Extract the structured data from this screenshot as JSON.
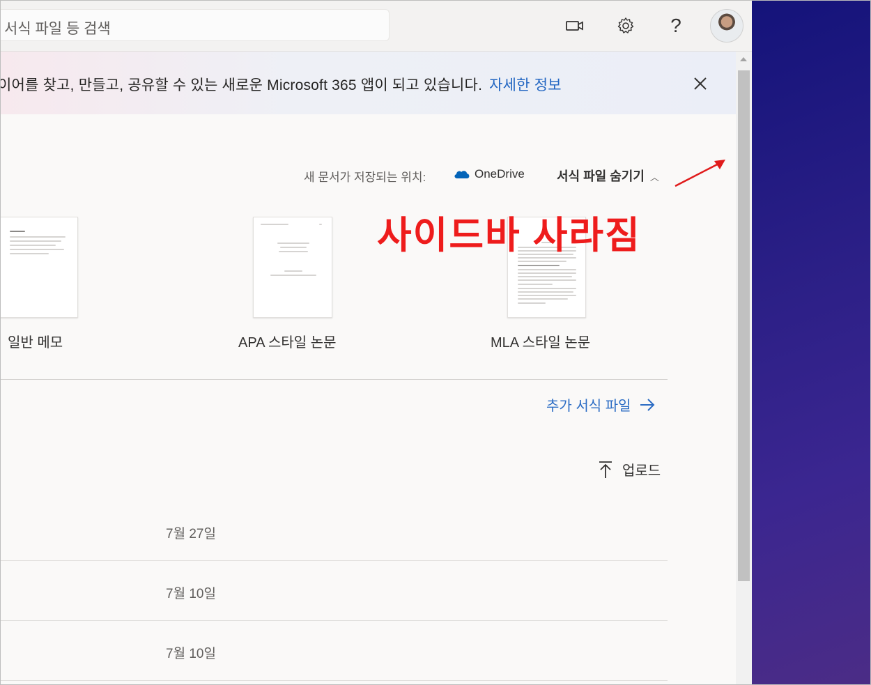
{
  "search": {
    "placeholder": "서식 파일 등 검색"
  },
  "topbar": {
    "icons": [
      "video-icon",
      "gear-icon",
      "help-icon",
      "avatar"
    ]
  },
  "banner": {
    "text": "이어를 찾고, 만들고, 공유할 수 있는 새로운 Microsoft 365 앱이 되고 있습니다.",
    "link": "자세한 정보"
  },
  "templates_header": {
    "save_location_label": "새 문서가 저장되는 위치:",
    "save_location_value": "OneDrive",
    "hide_templates": "서식 파일 숨기기"
  },
  "templates": [
    {
      "label": "일반 메모"
    },
    {
      "label": "APA 스타일 논문"
    },
    {
      "label": "MLA 스타일 논문"
    }
  ],
  "more_templates": "추가 서식 파일",
  "upload": "업로드",
  "recent": [
    {
      "date": "7월 27일"
    },
    {
      "date": "7월 10일"
    },
    {
      "date": "7월 10일"
    }
  ],
  "annotation": {
    "text": "사이드바 사라짐",
    "color": "#ee1c1c"
  },
  "colors": {
    "link": "#2266c2",
    "onedrive": "#0364b8"
  }
}
